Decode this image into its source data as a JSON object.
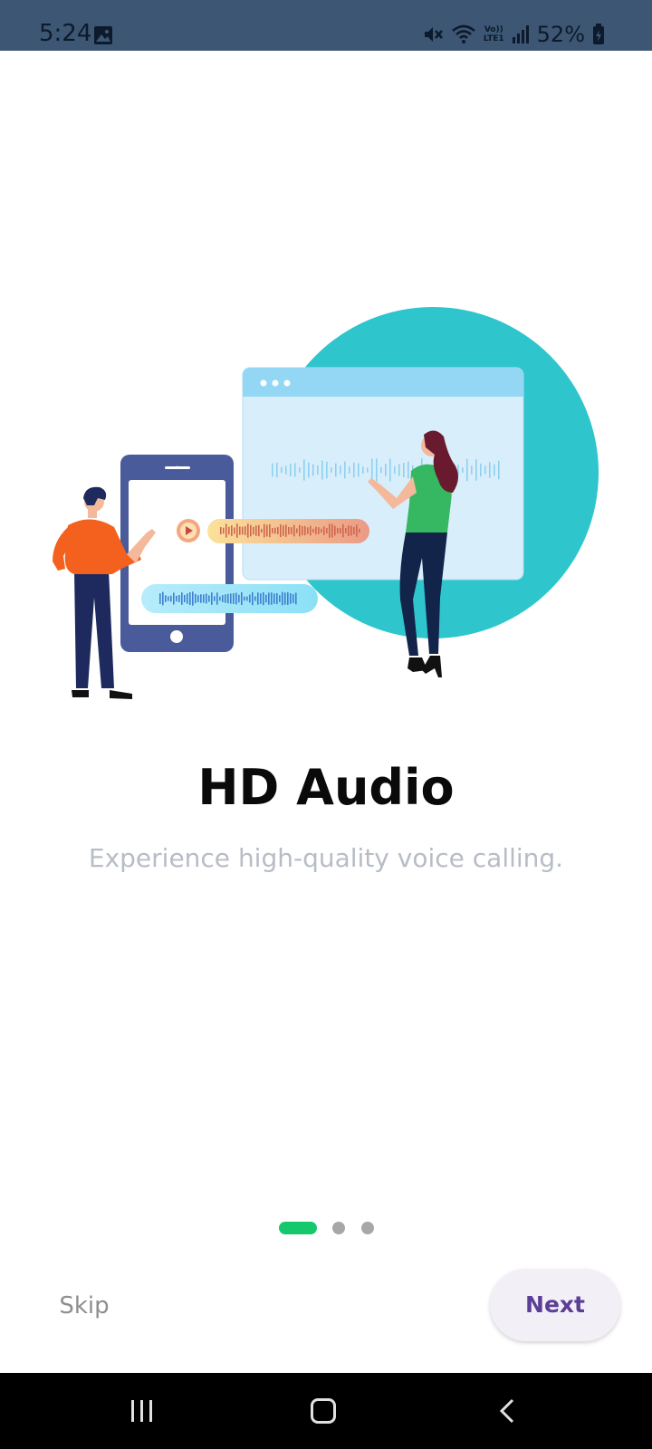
{
  "status_bar": {
    "time": "5:24",
    "volte_top": "Vo))",
    "volte_bottom": "LTE1",
    "battery_percent": "52%",
    "icons": [
      "gallery-icon",
      "mute-icon",
      "wifi-icon",
      "volte-icon",
      "signal-icon",
      "battery-icon"
    ]
  },
  "onboarding": {
    "title": "HD Audio",
    "subtitle": "Experience high-quality voice calling.",
    "pages_total": 3,
    "current_page": 1
  },
  "actions": {
    "skip_label": "Skip",
    "next_label": "Next"
  },
  "nav_bar": {
    "icons": [
      "recents-icon",
      "home-icon",
      "back-icon"
    ]
  },
  "colors": {
    "status_bar_bg": "#3d5673",
    "accent_green": "#14c86b",
    "next_text": "#5b3f96",
    "next_bg": "#f3eff7",
    "circle_teal": "#2ec5cc"
  }
}
